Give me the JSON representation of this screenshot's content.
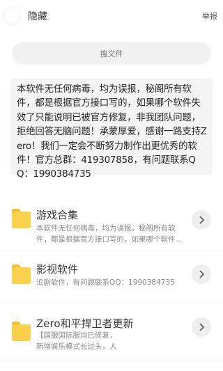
{
  "header": {
    "title": "隐藏",
    "report_label": "举报"
  },
  "search": {
    "label": "搜文件"
  },
  "notice": {
    "text": "本软件无任何病毒，均为误报，秘阁所有软件，都是根据官方接口写的，如果哪个软件失效了只能说明已被官方修复，非我团队问题，拒绝回答无脑问题！承蒙厚爱，感谢一路支持Zero！我们一定会不断努力制作出更优秀的软件！官方总群：419307858，有问题联系QQ：1990384735"
  },
  "items": [
    {
      "name": "游戏合集",
      "desc": "本软件无任何病毒，均为误报，秘阁所有软件，都是根据官方接口写的，如果哪个软件..."
    },
    {
      "name": "影视软件",
      "desc": "追剧软件，有问题联系QQ：1990384735"
    },
    {
      "name": "Zero和平捍卫者更新",
      "desc": "【国服国际服均已修复，新增娱乐模式长过头，人物白色"
    }
  ],
  "icons": {
    "folder": "folder-icon",
    "arrow": "chevron-right-icon"
  },
  "colors": {
    "folder": "#fbd04b",
    "background": "#ffffff",
    "panel": "#f4f4f4"
  }
}
